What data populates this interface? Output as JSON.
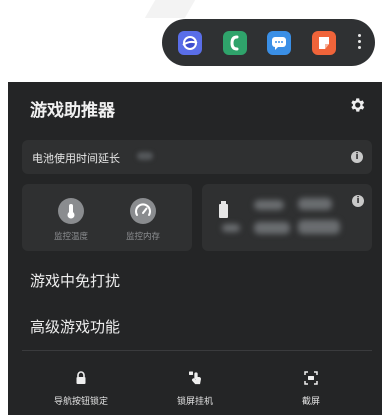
{
  "edge_panel": {
    "apps": [
      {
        "icon": "samsung-internet-icon",
        "color": "#5a6ee8"
      },
      {
        "icon": "phone-icon",
        "color": "#2fa36b"
      },
      {
        "icon": "messages-icon",
        "color": "#3a8fe6"
      },
      {
        "icon": "notes-app-icon",
        "color": "#f0643a"
      }
    ],
    "more_icon": "more-vertical-icon"
  },
  "game_booster": {
    "title": "游戏助推器",
    "settings_icon": "gear-icon",
    "battery": {
      "label": "电池使用时间延长",
      "info_icon": "info-icon"
    },
    "monitors": [
      {
        "label": "监控温度",
        "icon": "thermometer-icon"
      },
      {
        "label": "监控内存",
        "icon": "gauge-icon"
      }
    ],
    "stats": {
      "icon": "battery-icon",
      "info_icon": "info-icon"
    },
    "menu": [
      {
        "label": "游戏中免打扰"
      },
      {
        "label": "高级游戏功能"
      }
    ],
    "bottom_actions": [
      {
        "label": "导航按钮锁定",
        "icon": "lock-icon"
      },
      {
        "label": "锁屏挂机",
        "icon": "touch-lock-icon"
      },
      {
        "label": "截屏",
        "icon": "screenshot-icon"
      }
    ]
  },
  "colors": {
    "panel_bg": "#242526",
    "card_bg": "#2f3031",
    "edge_bar_bg": "#2f3133"
  }
}
